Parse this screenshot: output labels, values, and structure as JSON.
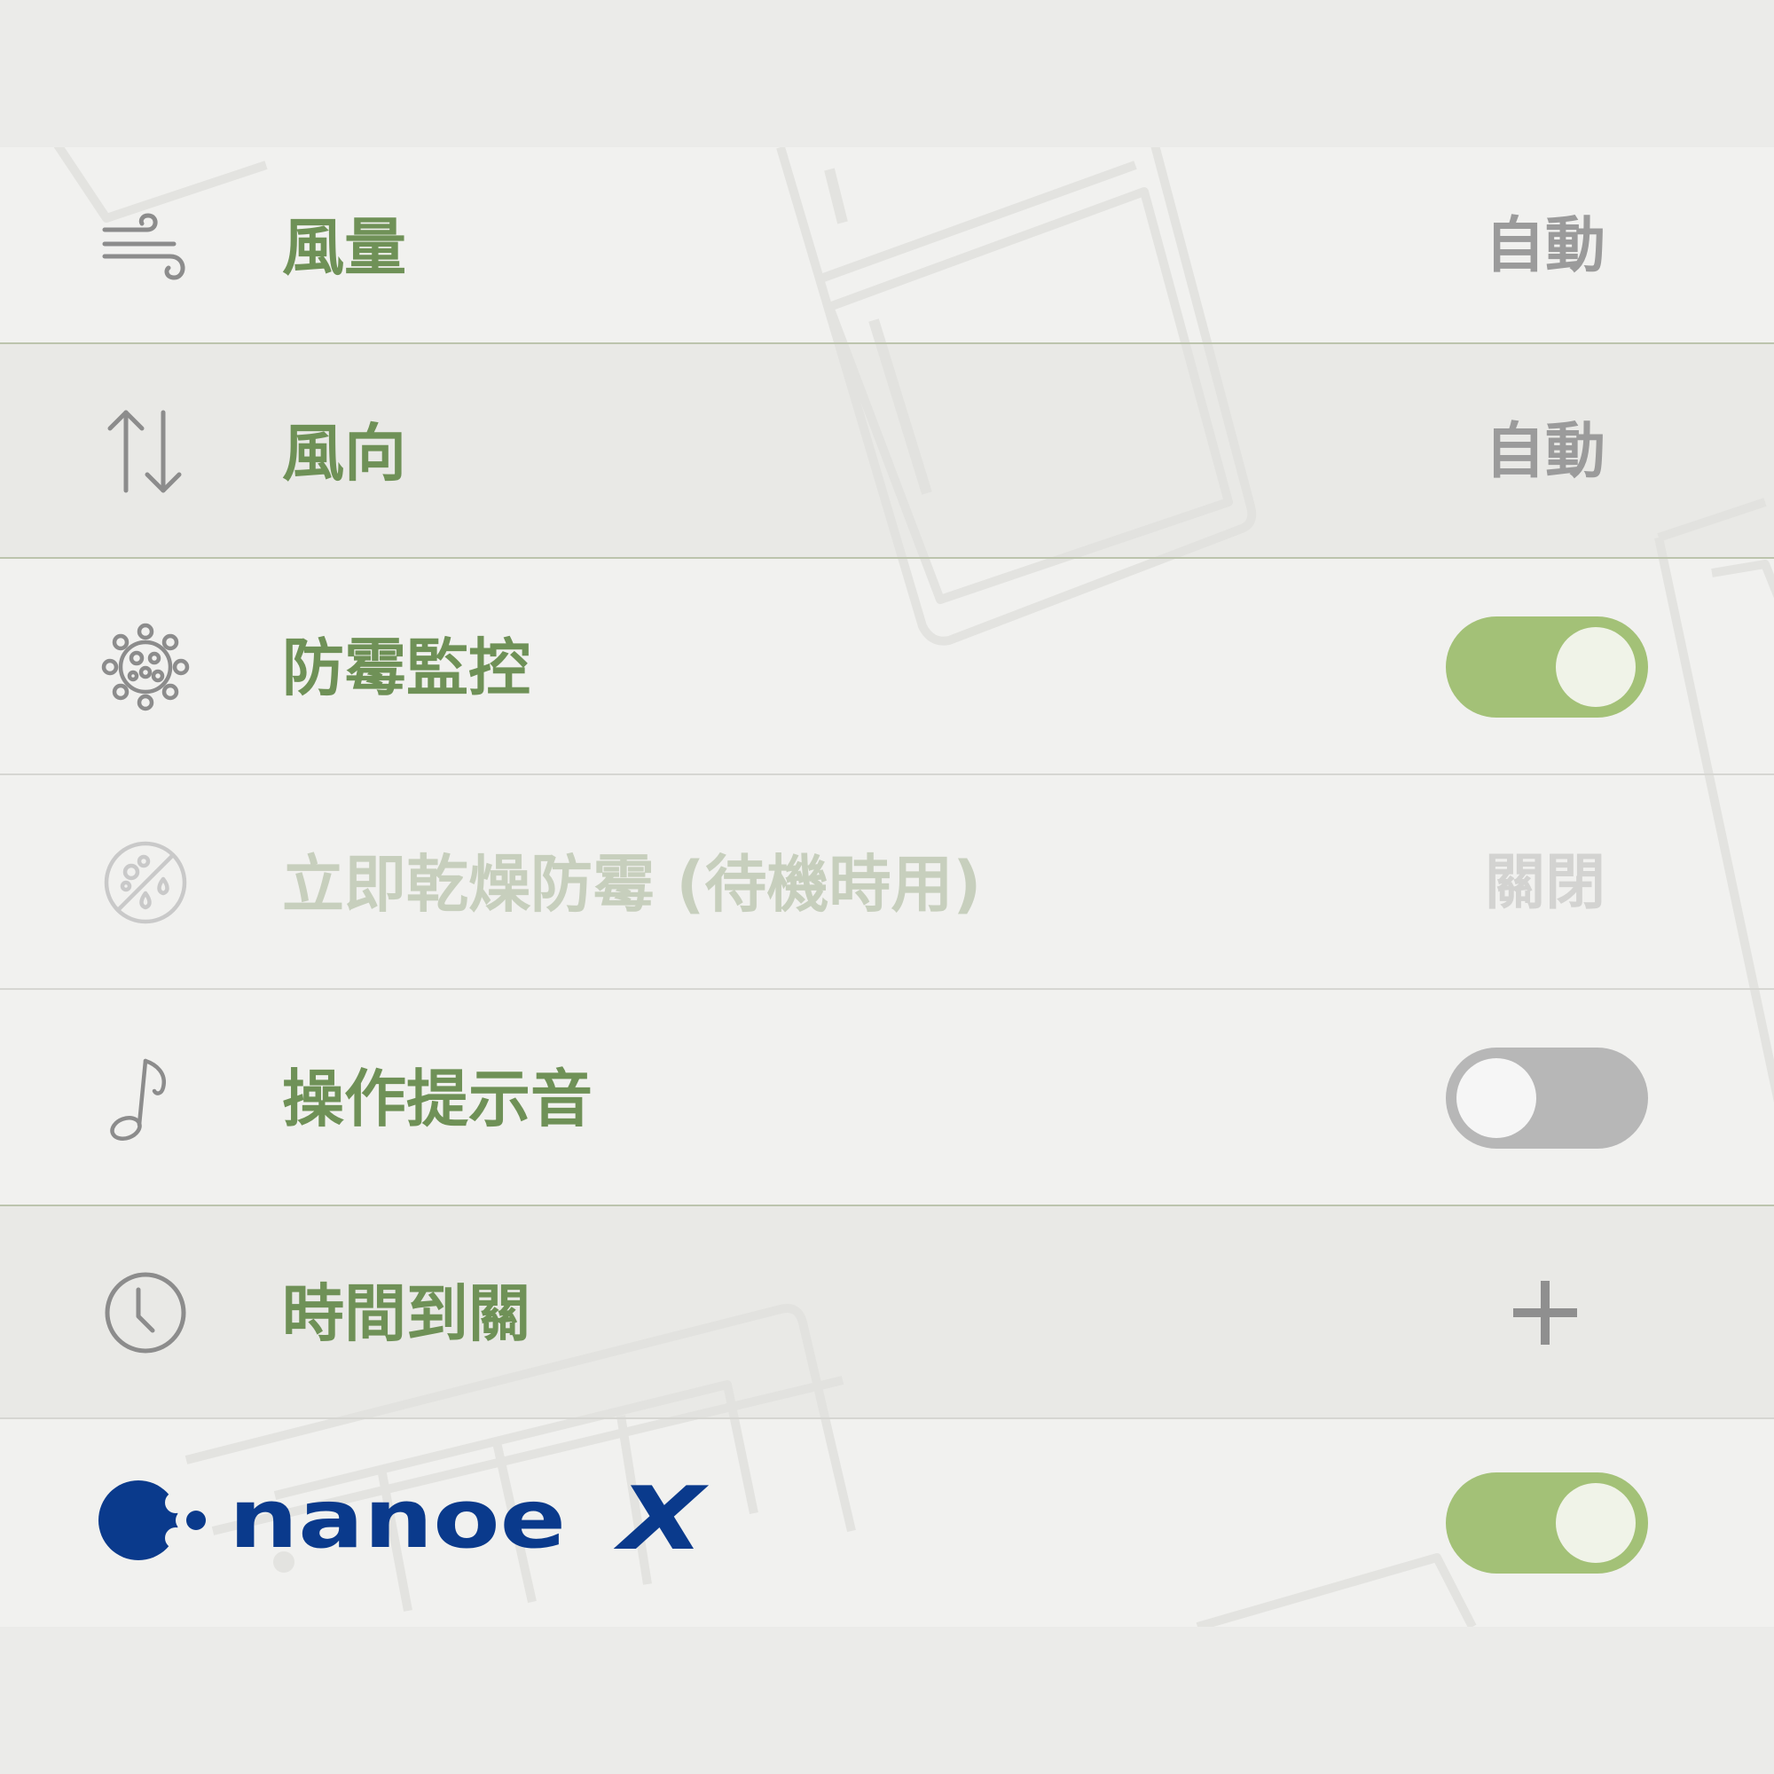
{
  "settings": {
    "fan_speed": {
      "icon": "wind-icon",
      "label": "風量",
      "value": "自動"
    },
    "wind_direction": {
      "icon": "up-down-arrows-icon",
      "label": "風向",
      "value": "自動"
    },
    "mold_monitor": {
      "icon": "mold-cell-icon",
      "label": "防霉監控",
      "toggle": "on"
    },
    "instant_dry": {
      "icon": "mold-drop-circle-icon",
      "label": "立即乾燥防霉 (待機時用)",
      "value": "關閉",
      "state": "disabled"
    },
    "operation_sound": {
      "icon": "music-note-icon",
      "label": "操作提示音",
      "toggle": "off"
    },
    "off_timer": {
      "icon": "clock-icon",
      "label": "時間到關",
      "action_icon": "plus-icon"
    },
    "nanoe_x": {
      "brand_text": "nanoe X",
      "brand_color": "#0a3a8c",
      "toggle": "on"
    }
  },
  "colors": {
    "label_green": "#6f9157",
    "toggle_on": "#a3c177",
    "toggle_off": "#b7b7b7",
    "value_gray": "#9b9b9b"
  }
}
